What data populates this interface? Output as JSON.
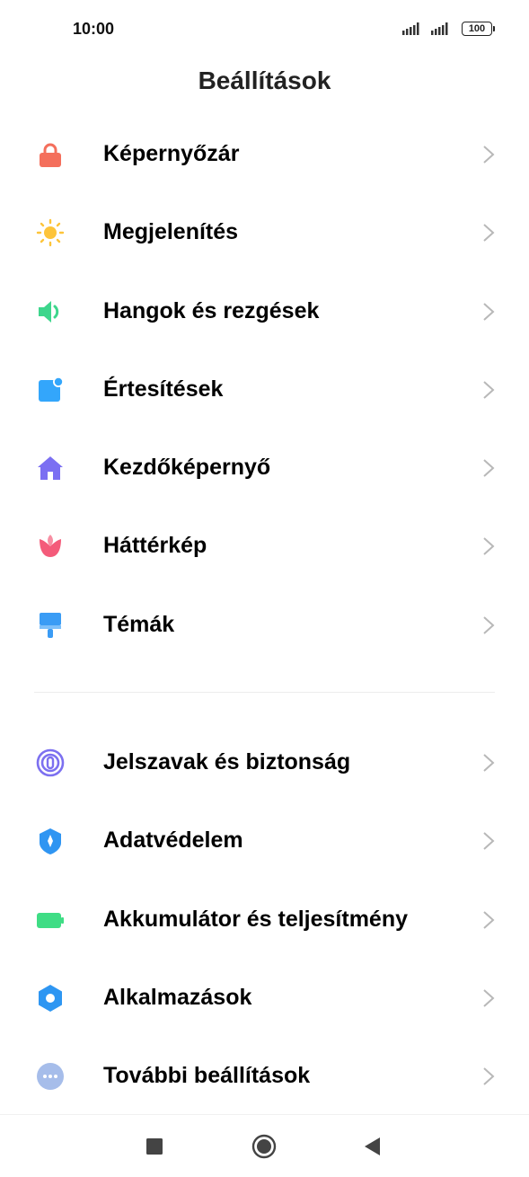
{
  "status_bar": {
    "time": "10:00",
    "battery": "100",
    "icons": [
      "signal-icon",
      "signal-icon",
      "battery-icon"
    ]
  },
  "page_title": "Beállítások",
  "sections": [
    {
      "items": [
        {
          "label": "Képernyőzár",
          "icon": "lock-icon",
          "color": "#F46F5C"
        },
        {
          "label": "Megjelenítés",
          "icon": "sun-icon",
          "color": "#FDC43A"
        },
        {
          "label": "Hangok és rezgések",
          "icon": "speaker-icon",
          "color": "#3DD68C"
        },
        {
          "label": "Értesítések",
          "icon": "notification-icon",
          "color": "#33A6FB"
        },
        {
          "label": "Kezdőképernyő",
          "icon": "home-icon",
          "color": "#7B6FF2"
        },
        {
          "label": "Háttérkép",
          "icon": "tulip-icon",
          "color": "#F45B7A"
        },
        {
          "label": "Témák",
          "icon": "paintbrush-icon",
          "color": "#3A9CF5"
        }
      ]
    },
    {
      "items": [
        {
          "label": "Jelszavak és biztonság",
          "icon": "fingerprint-icon",
          "color": "#7C70F0"
        },
        {
          "label": "Adatvédelem",
          "icon": "shield-icon",
          "color": "#2F95F2"
        },
        {
          "label": "Akkumulátor és teljesítmény",
          "icon": "battery-icon",
          "color": "#3FDD85"
        },
        {
          "label": "Alkalmazások",
          "icon": "gear-icon",
          "color": "#2E96F2"
        },
        {
          "label": "További beállítások",
          "icon": "more-icon",
          "color": "#A6BDEA"
        }
      ]
    }
  ],
  "nav_bar": {
    "icons": [
      "recents-square-icon",
      "home-circle-icon",
      "back-triangle-icon"
    ]
  }
}
